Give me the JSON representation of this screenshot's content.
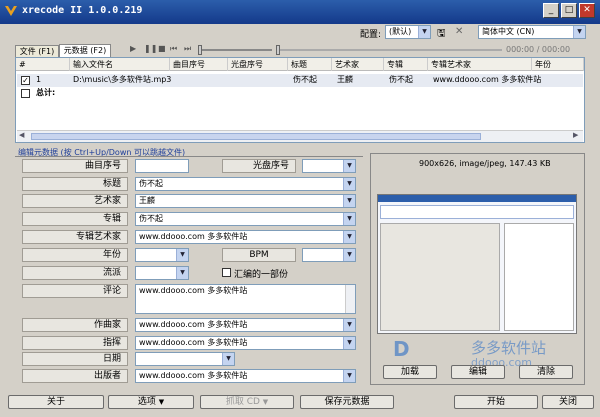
{
  "window": {
    "title": "xrecode II 1.0.0.219"
  },
  "toolbar": {
    "config_label": "配置:",
    "config_value": "(默认)",
    "language_value": "简体中文 (CN)",
    "time_text": "000:00 / 000:00",
    "controls": [
      "play-icon",
      "pause-icon",
      "stop-icon",
      "prev-icon",
      "next-icon"
    ]
  },
  "tabs": [
    {
      "label": "文件 (F1)"
    },
    {
      "label": "元数据 (F2)"
    }
  ],
  "filelist": {
    "columns": [
      "#",
      "输入文件名",
      "曲目序号",
      "光盘序号",
      "标题",
      "艺术家",
      "专辑",
      "专辑艺术家",
      "年份"
    ],
    "rows": [
      {
        "num": "1",
        "file": "D:\\music\\多多软件站.mp3",
        "title": "伤不起",
        "artist": "王麟",
        "album": "伤不起",
        "album_artist": "www.ddooo.com 多多软件站",
        "checked": true
      }
    ],
    "total_label": "总计:"
  },
  "meta": {
    "heading": "编辑元数据 (按 Ctrl+Up/Down 可以跳越文件)",
    "labels": {
      "track": "曲目序号",
      "disc": "光盘序号",
      "title": "标题",
      "artist": "艺术家",
      "album": "专辑",
      "album_artist": "专辑艺术家",
      "year": "年份",
      "bpm": "BPM",
      "genre": "流派",
      "compilation": "汇编的一部份",
      "comment": "评论",
      "composer": "作曲家",
      "conductor": "指挥",
      "date": "日期",
      "publisher": "出版者"
    },
    "values": {
      "track": "",
      "disc": "",
      "title": "伤不起",
      "artist": "王麟",
      "album": "伤不起",
      "album_artist": "www.ddooo.com 多多软件站",
      "year": "",
      "bpm": "",
      "genre": "",
      "comment": "www.ddooo.com 多多软件站",
      "composer": "www.ddooo.com 多多软件站",
      "conductor": "www.ddooo.com 多多软件站",
      "date": "",
      "publisher": "www.ddooo.com 多多软件站"
    }
  },
  "cover": {
    "info": "900x626, image/jpeg, 147.43 KB",
    "add": "加载",
    "edit": "编辑",
    "clear": "清除"
  },
  "bottom": {
    "about": "关于",
    "options": "选项",
    "rip": "抓取 CD",
    "save_meta": "保存元数据",
    "start": "开始",
    "close": "关闭"
  },
  "watermark": {
    "text": "多多软件站",
    "url": "ddooo.com"
  }
}
